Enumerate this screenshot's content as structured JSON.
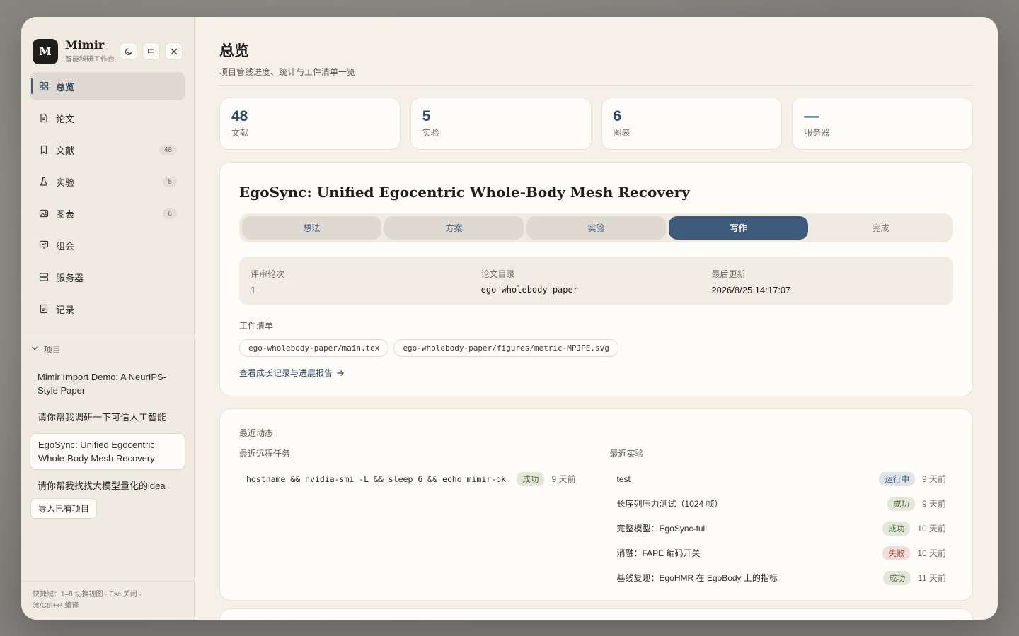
{
  "brand": {
    "logo_letter": "M",
    "name": "Mimir",
    "subtitle": "智能科研工作台",
    "lang_label": "中"
  },
  "nav": [
    {
      "label": "总览",
      "icon": "grid-icon",
      "count": null,
      "active": true
    },
    {
      "label": "论文",
      "icon": "document-icon",
      "count": null
    },
    {
      "label": "文献",
      "icon": "bookmark-icon",
      "count": "48"
    },
    {
      "label": "实验",
      "icon": "flask-icon",
      "count": "5"
    },
    {
      "label": "图表",
      "icon": "image-icon",
      "count": "6"
    },
    {
      "label": "组会",
      "icon": "presentation-icon",
      "count": null
    },
    {
      "label": "服务器",
      "icon": "server-icon",
      "count": null
    },
    {
      "label": "记录",
      "icon": "notes-icon",
      "count": null
    }
  ],
  "projects": {
    "header": "项目",
    "items": [
      "Mimir Import Demo: A NeurIPS-Style Paper",
      "请你帮我调研一下可信人工智能",
      "EgoSync: Unified Egocentric Whole-Body Mesh Recovery",
      "请你帮我找找大模型量化的idea"
    ],
    "active_index": 2,
    "import_label": "导入已有项目"
  },
  "shortcut": {
    "line1": "快捷键：1–8 切换视图 · Esc 关闭 ·",
    "line2": "⌘/Ctrl+↵ 编译"
  },
  "page": {
    "title": "总览",
    "subtitle": "项目管线进度、统计与工件清单一览"
  },
  "stats": [
    {
      "value": "48",
      "label": "文献"
    },
    {
      "value": "5",
      "label": "实验"
    },
    {
      "value": "6",
      "label": "图表"
    },
    {
      "value": "—",
      "label": "服务器"
    }
  ],
  "project": {
    "title": "EgoSync: Unified Egocentric Whole-Body Mesh Recovery",
    "stages": [
      "想法",
      "方案",
      "实验",
      "写作",
      "完成"
    ],
    "current_stage": 3,
    "meta": {
      "review_label": "评审轮次",
      "review_value": "1",
      "dir_label": "论文目录",
      "dir_value": "ego-wholebody-paper",
      "updated_label": "最后更新",
      "updated_value": "2026/8/25 14:17:07"
    },
    "manifest_label": "工件清单",
    "artifacts": [
      "ego-wholebody-paper/main.tex",
      "ego-wholebody-paper/figures/metric-MPJPE.svg"
    ],
    "link_label": "查看成长记录与进展报告"
  },
  "activity": {
    "title": "最近动态",
    "remote_head": "最近远程任务",
    "remote": [
      {
        "text": "hostname && nvidia-smi -L && sleep 6 && echo mimir-ok",
        "status": "成功",
        "kind": "success",
        "time": "9 天前"
      }
    ],
    "exp_head": "最近实验",
    "experiments": [
      {
        "text": "test",
        "status": "运行中",
        "kind": "running",
        "time": "9 天前"
      },
      {
        "text": "长序列压力测试（1024 帧）",
        "status": "成功",
        "kind": "success",
        "time": "9 天前"
      },
      {
        "text": "完整模型：EgoSync-full",
        "status": "成功",
        "kind": "success",
        "time": "10 天前"
      },
      {
        "text": "消融：FAPE 编码开关",
        "status": "失败",
        "kind": "failed",
        "time": "10 天前"
      },
      {
        "text": "基线复现：EgoHMR 在 EgoBody 上的指标",
        "status": "成功",
        "kind": "success",
        "time": "11 天前"
      }
    ]
  },
  "colors": {
    "accent": "#3d5a7a",
    "success": "#557048",
    "failed": "#a44a3c"
  }
}
